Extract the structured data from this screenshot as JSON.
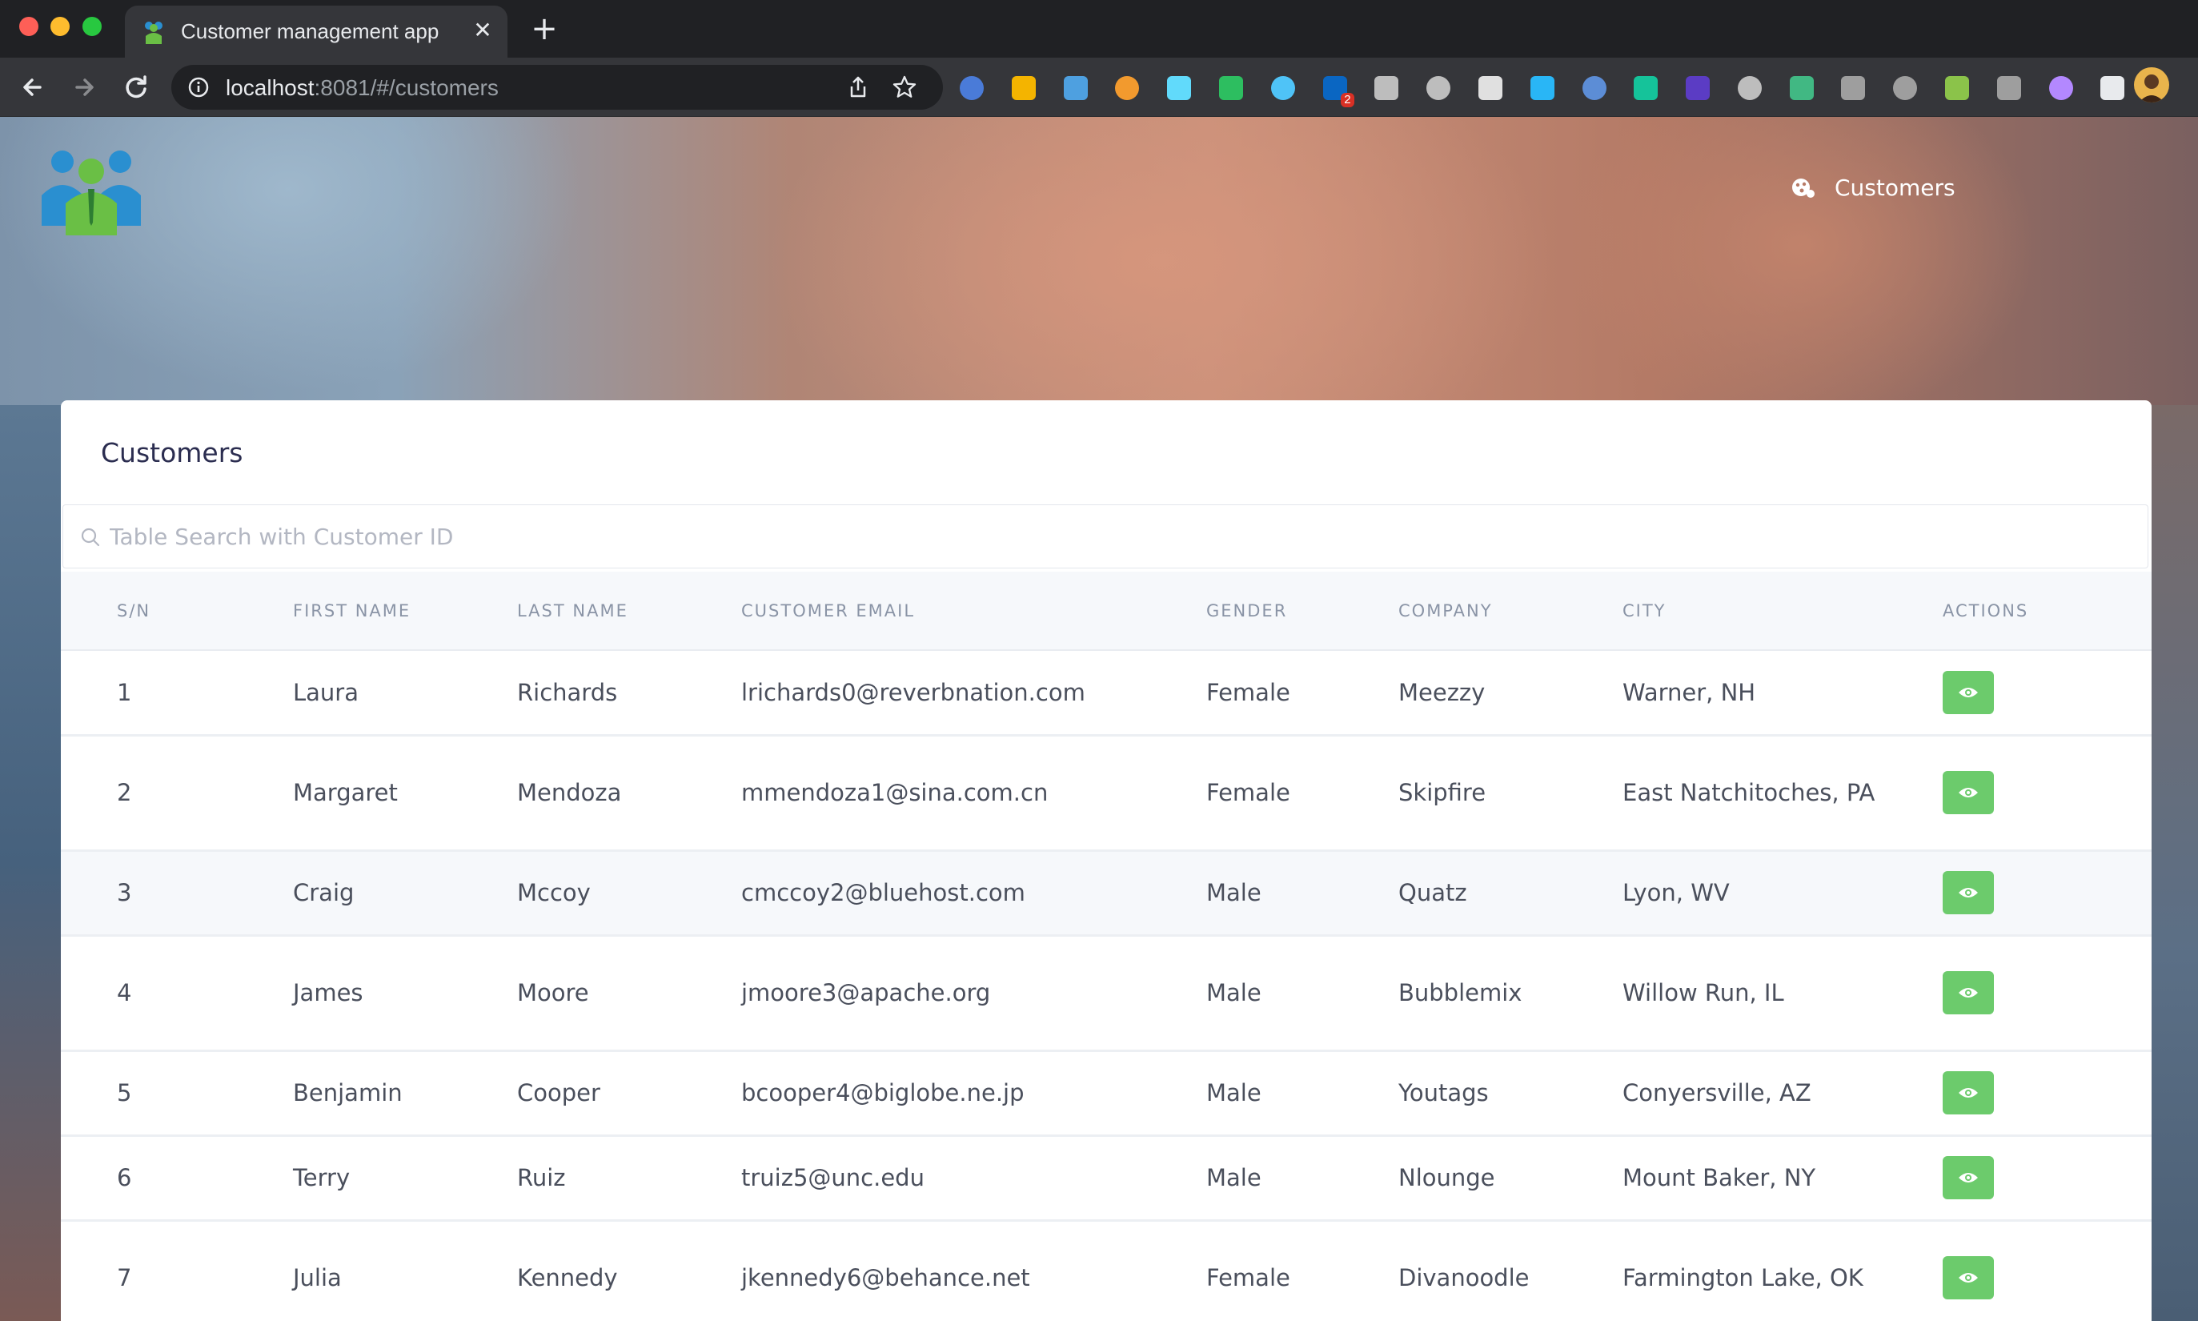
{
  "browser": {
    "tab_title": "Customer management app",
    "tab_close_icon": "close-icon",
    "new_tab_icon": "plus-icon",
    "url_host": "localhost",
    "url_rest": ":8081/#/customers",
    "extensions": [
      {
        "name": "google-translate-icon",
        "color": "#4a7bd8"
      },
      {
        "name": "google-drive-icon",
        "color": "#f4b400"
      },
      {
        "name": "extension-icon",
        "color": "#4ea0e0"
      },
      {
        "name": "compass-icon",
        "color": "#f29a2e"
      },
      {
        "name": "react-devtools-icon",
        "color": "#61dafb"
      },
      {
        "name": "evernote-icon",
        "color": "#2dbe60"
      },
      {
        "name": "react-icon",
        "color": "#4fc3f7"
      },
      {
        "name": "linkedin-icon",
        "color": "#0a66c2",
        "badge": "2"
      },
      {
        "name": "target-icon",
        "color": "#bdbdbd"
      },
      {
        "name": "pocket-icon",
        "color": "#bdbdbd"
      },
      {
        "name": "json-icon",
        "color": "#e0e0e0"
      },
      {
        "name": "capture-icon",
        "color": "#29b6f6"
      },
      {
        "name": "notes-icon",
        "color": "#5c8dd6"
      },
      {
        "name": "grammarly-icon",
        "color": "#15c39a"
      },
      {
        "name": "cursor-icon",
        "color": "#5b3cc4"
      },
      {
        "name": "layers-icon",
        "color": "#bdbdbd"
      },
      {
        "name": "vue-devtools-icon",
        "color": "#41b883"
      },
      {
        "name": "pen-icon",
        "color": "#9e9e9e"
      },
      {
        "name": "check-circle-icon",
        "color": "#9e9e9e"
      },
      {
        "name": "phone-icon",
        "color": "#8bc34a"
      },
      {
        "name": "wave-icon",
        "color": "#9e9e9e"
      },
      {
        "name": "feather-icon",
        "color": "#b388ff"
      },
      {
        "name": "puzzle-icon",
        "color": "#e8eaed"
      }
    ]
  },
  "nav": {
    "customers_label": "Customers"
  },
  "card": {
    "title": "Customers",
    "search_placeholder": "Table Search with Customer ID"
  },
  "table": {
    "headers": {
      "sn": "S/N",
      "first_name": "FIRST NAME",
      "last_name": "LAST NAME",
      "email": "CUSTOMER EMAIL",
      "gender": "GENDER",
      "company": "COMPANY",
      "city": "CITY",
      "actions": "ACTIONS"
    },
    "rows": [
      {
        "sn": "1",
        "first": "Laura",
        "last": "Richards",
        "email": "lrichards0@reverbnation.com",
        "gender": "Female",
        "company": "Meezzy",
        "city": "Warner, NH"
      },
      {
        "sn": "2",
        "first": "Margaret",
        "last": "Mendoza",
        "email": "mmendoza1@sina.com.cn",
        "gender": "Female",
        "company": "Skipfire",
        "city": "East Natchitoches, PA"
      },
      {
        "sn": "3",
        "first": "Craig",
        "last": "Mccoy",
        "email": "cmccoy2@bluehost.com",
        "gender": "Male",
        "company": "Quatz",
        "city": "Lyon, WV"
      },
      {
        "sn": "4",
        "first": "James",
        "last": "Moore",
        "email": "jmoore3@apache.org",
        "gender": "Male",
        "company": "Bubblemix",
        "city": "Willow Run, IL"
      },
      {
        "sn": "5",
        "first": "Benjamin",
        "last": "Cooper",
        "email": "bcooper4@biglobe.ne.jp",
        "gender": "Male",
        "company": "Youtags",
        "city": "Conyersville, AZ"
      },
      {
        "sn": "6",
        "first": "Terry",
        "last": "Ruiz",
        "email": "truiz5@unc.edu",
        "gender": "Male",
        "company": "Nlounge",
        "city": "Mount Baker, NY"
      },
      {
        "sn": "7",
        "first": "Julia",
        "last": "Kennedy",
        "email": "jkennedy6@behance.net",
        "gender": "Female",
        "company": "Divanoodle",
        "city": "Farmington Lake, OK"
      }
    ]
  },
  "colors": {
    "view_button": "#6ccb6c",
    "title_text": "#2b2d50",
    "header_bg": "#f6f8fb"
  }
}
